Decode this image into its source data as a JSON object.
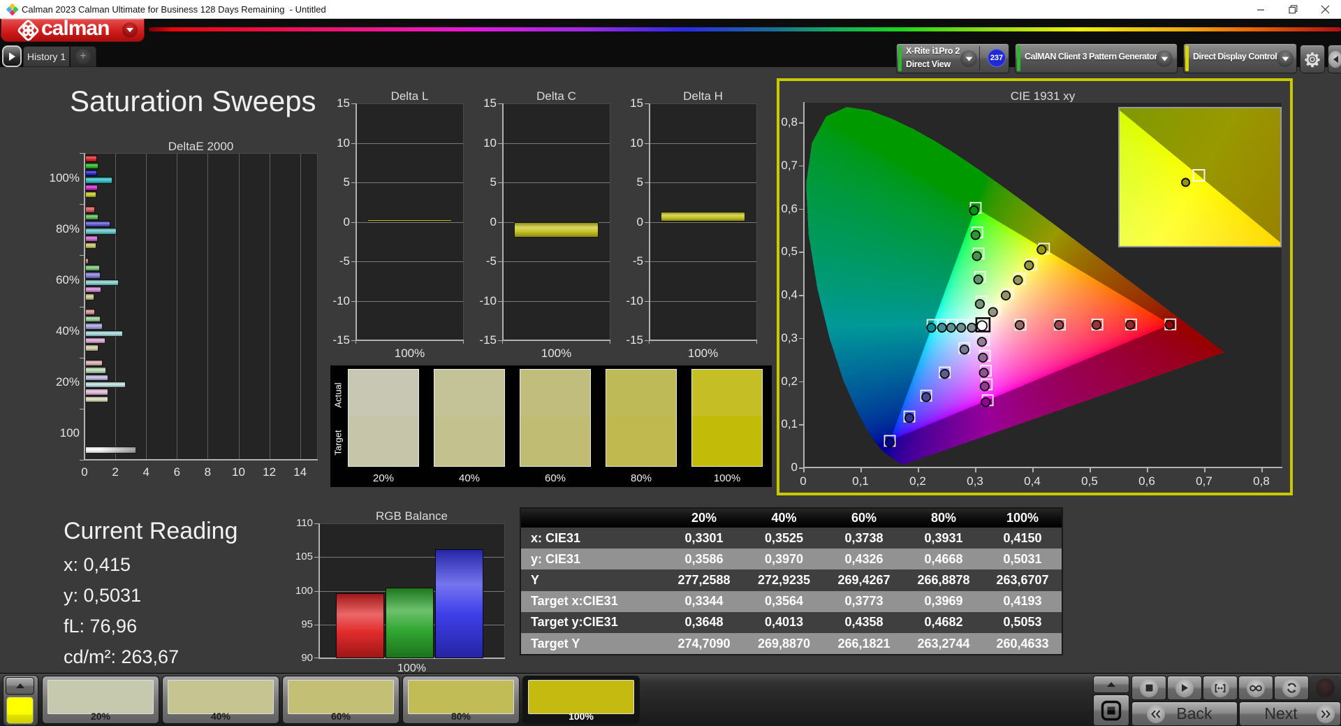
{
  "window": {
    "title": "Calman 2023 Calman Ultimate for Business 128 Days Remaining  - Untitled"
  },
  "header": {
    "logo_text": "calman",
    "meter": {
      "line1": "X-Rite i1Pro 2",
      "line2": "Direct View",
      "badge": "237"
    },
    "source": "CalMAN Client 3 Pattern Generator",
    "display_control": "Direct Display Control"
  },
  "tabs": {
    "history": "History 1",
    "add": "+"
  },
  "page": {
    "title": "Saturation Sweeps"
  },
  "chart_data": [
    {
      "id": "deltae2000",
      "type": "bar",
      "orientation": "horizontal",
      "title": "DeltaE 2000",
      "xlim": [
        0,
        15.2
      ],
      "xticks": [
        0,
        2,
        4,
        6,
        8,
        10,
        12,
        14
      ],
      "series_labels": [
        "red",
        "green",
        "blue",
        "cyan",
        "magenta",
        "yellow"
      ],
      "groups": [
        {
          "label": "100%",
          "values": [
            0.79,
            0.88,
            0.79,
            1.79,
            0.82,
            0.74
          ],
          "colors": [
            "#d42020",
            "#1fb81f",
            "#2222cc",
            "#2cbfc4",
            "#c828c8",
            "#c6c620"
          ]
        },
        {
          "label": "80%",
          "values": [
            0.62,
            0.88,
            1.65,
            2.03,
            0.8,
            0.74
          ],
          "colors": [
            "#d05050",
            "#52bb52",
            "#5b55cf",
            "#63c3c6",
            "#cc63cc",
            "#c6c45e"
          ]
        },
        {
          "label": "60%",
          "values": [
            0.24,
            0.97,
            1.0,
            2.18,
            1.06,
            0.59
          ],
          "colors": [
            "#cd7070",
            "#76c276",
            "#8379d4",
            "#85ccce",
            "#ce86ce",
            "#c9c787"
          ]
        },
        {
          "label": "40%",
          "values": [
            0.62,
            1.02,
            1.12,
            2.45,
            1.3,
            0.85
          ],
          "colors": [
            "#d29090",
            "#94cb94",
            "#a29ddb",
            "#a4d6d6",
            "#d6a3d2",
            "#cfcda2"
          ]
        },
        {
          "label": "20%",
          "values": [
            1.15,
            1.36,
            1.51,
            2.61,
            1.51,
            1.51
          ],
          "colors": [
            "#d8acac",
            "#b2d8b2",
            "#bcb6e3",
            "#b9dedd",
            "#dfb9d9",
            "#d6d5b4"
          ]
        },
        {
          "label": "100",
          "values": [
            3.3
          ],
          "colors": [
            "#ffffff"
          ]
        }
      ]
    },
    {
      "id": "delta_l",
      "type": "bar",
      "title": "Delta L",
      "ylim": [
        -15,
        15
      ],
      "yticks": [
        15,
        10,
        5,
        0,
        -5,
        -10,
        -15
      ],
      "category": "100%",
      "value": 0.3,
      "color": "#c6c41d"
    },
    {
      "id": "delta_c",
      "type": "bar",
      "title": "Delta C",
      "ylim": [
        -15,
        15
      ],
      "yticks": [
        15,
        10,
        5,
        0,
        -5,
        -10,
        -15
      ],
      "category": "100%",
      "value": -2.0,
      "color": "#c6c41d"
    },
    {
      "id": "delta_h",
      "type": "bar",
      "title": "Delta H",
      "ylim": [
        -15,
        15
      ],
      "yticks": [
        15,
        10,
        5,
        0,
        -5,
        -10,
        -15
      ],
      "category": "100%",
      "value": 1.3,
      "color": "#c6c41d"
    },
    {
      "id": "saturation_swatches",
      "type": "table",
      "row_labels": [
        "Actual",
        "Target"
      ],
      "levels": [
        "20%",
        "40%",
        "60%",
        "80%",
        "100%"
      ],
      "actual": [
        "#c7c7b4",
        "#c4c297",
        "#c1bd7c",
        "#bfba58",
        "#c5be24"
      ],
      "target": [
        "#c6c5a9",
        "#c3c18e",
        "#c0bc73",
        "#bfb94f",
        "#c2bb07"
      ]
    },
    {
      "id": "cie1931",
      "type": "scatter",
      "title": "CIE 1931 xy",
      "xlim": [
        0,
        0.8366
      ],
      "ylim": [
        0,
        0.8469
      ],
      "xtick_labels": [
        "0",
        "0,1",
        "0,2",
        "0,3",
        "0,4",
        "0,5",
        "0,6",
        "0,7",
        "0,8"
      ],
      "ytick_labels": [
        "0",
        "0,1",
        "0,2",
        "0,3",
        "0,4",
        "0,5",
        "0,6",
        "0,7",
        "0,8"
      ],
      "gamut": {
        "red": [
          0.64,
          0.33
        ],
        "green": [
          0.3,
          0.6
        ],
        "blue": [
          0.15,
          0.06
        ]
      },
      "white_point": {
        "target": [
          0.3127,
          0.329
        ],
        "measured": [
          0.311,
          0.3267
        ]
      },
      "sweeps": {
        "red": {
          "target": [
            [
              0.3782,
              0.3292
            ],
            [
              0.4469,
              0.3294
            ],
            [
              0.5124,
              0.3296
            ],
            [
              0.5713,
              0.3298
            ],
            [
              0.64,
              0.33
            ]
          ],
          "measured": [
            [
              0.3767,
              0.3284
            ],
            [
              0.4454,
              0.3286
            ],
            [
              0.5109,
              0.3288
            ],
            [
              0.5698,
              0.329
            ],
            [
              0.6385,
              0.3292
            ]
          ]
        },
        "green": {
          "target": [
            [
              0.3102,
              0.3832
            ],
            [
              0.3075,
              0.4401
            ],
            [
              0.305,
              0.4943
            ],
            [
              0.3027,
              0.5431
            ],
            [
              0.3,
              0.6
            ]
          ],
          "measured": [
            [
              0.3072,
              0.3772
            ],
            [
              0.3045,
              0.4341
            ],
            [
              0.302,
              0.4883
            ],
            [
              0.2997,
              0.5371
            ],
            [
              0.297,
              0.594
            ]
          ]
        },
        "blue": {
          "target": [
            [
              0.2802,
              0.2752
            ],
            [
              0.246,
              0.2187
            ],
            [
              0.2135,
              0.1649
            ],
            [
              0.1842,
              0.1165
            ],
            [
              0.15,
              0.06
            ]
          ],
          "measured": [
            [
              0.2802,
              0.2717
            ],
            [
              0.246,
              0.2152
            ],
            [
              0.2135,
              0.1614
            ],
            [
              0.1842,
              0.113
            ],
            [
              0.15,
              0.0565
            ]
          ]
        },
        "cyan": {
          "target": [
            [
              0.2951,
              0.3289
            ],
            [
              0.2766,
              0.3289
            ],
            [
              0.259,
              0.3288
            ],
            [
              0.2431,
              0.3288
            ],
            [
              0.2246,
              0.3287
            ]
          ],
          "measured": [
            [
              0.2931,
              0.3224
            ],
            [
              0.2746,
              0.3224
            ],
            [
              0.257,
              0.3223
            ],
            [
              0.2411,
              0.3223
            ],
            [
              0.2226,
              0.3222
            ]
          ]
        },
        "magenta": {
          "target": [
            [
              0.3143,
              0.294
            ],
            [
              0.3161,
              0.2573
            ],
            [
              0.3177,
              0.2224
            ],
            [
              0.3192,
              0.1909
            ],
            [
              0.3209,
              0.1542
            ]
          ],
          "measured": [
            [
              0.3108,
              0.2895
            ],
            [
              0.3126,
              0.2528
            ],
            [
              0.3142,
              0.2179
            ],
            [
              0.3157,
              0.1864
            ],
            [
              0.3174,
              0.1497
            ]
          ]
        },
        "yellow": {
          "target": [
            [
              0.3344,
              0.3648
            ],
            [
              0.3564,
              0.4013
            ],
            [
              0.3773,
              0.4358
            ],
            [
              0.3969,
              0.4682
            ],
            [
              0.4193,
              0.5053
            ]
          ],
          "measured": [
            [
              0.3301,
              0.3586
            ],
            [
              0.3525,
              0.397
            ],
            [
              0.3738,
              0.4326
            ],
            [
              0.3931,
              0.4668
            ],
            [
              0.415,
              0.5031
            ]
          ]
        }
      },
      "inset": {
        "x0": 0.3935,
        "x1": 0.4458,
        "y0": 0.4831,
        "y1": 0.5264,
        "target": [
          0.4193,
          0.5053
        ],
        "measured": [
          0.415,
          0.5031
        ]
      }
    },
    {
      "id": "rgb_balance",
      "type": "bar",
      "title": "RGB Balance",
      "categories": [
        "Red",
        "Green",
        "Blue"
      ],
      "values": [
        99.6,
        100.5,
        106.2
      ],
      "colors": [
        "#e02020",
        "#28a428",
        "#3434e8"
      ],
      "ylim": [
        90,
        110
      ],
      "yticks": [
        110,
        105,
        100,
        95,
        90
      ],
      "xlabel": "100%"
    }
  ],
  "current_reading": {
    "title": "Current Reading",
    "lines": [
      "x: 0,415",
      "y: 0,5031",
      "fL: 76,96",
      "cd/m²: 263,67"
    ]
  },
  "table": {
    "headers": [
      "",
      "20%",
      "40%",
      "60%",
      "80%",
      "100%"
    ],
    "rows": [
      {
        "label": "x: CIE31",
        "values": [
          "0,3301",
          "0,3525",
          "0,3738",
          "0,3931",
          "0,4150"
        ]
      },
      {
        "label": "y: CIE31",
        "values": [
          "0,3586",
          "0,3970",
          "0,4326",
          "0,4668",
          "0,5031"
        ]
      },
      {
        "label": "Y",
        "values": [
          "277,2588",
          "272,9235",
          "269,4267",
          "266,8878",
          "263,6707"
        ]
      },
      {
        "label": "Target x:CIE31",
        "values": [
          "0,3344",
          "0,3564",
          "0,3773",
          "0,3969",
          "0,4193"
        ]
      },
      {
        "label": "Target y:CIE31",
        "values": [
          "0,3648",
          "0,4013",
          "0,4358",
          "0,4682",
          "0,5053"
        ]
      },
      {
        "label": "Target Y",
        "values": [
          "274,7090",
          "269,8870",
          "266,1821",
          "263,2744",
          "260,4633"
        ]
      }
    ]
  },
  "bottom_bar": {
    "pattern_color": "#ffff00",
    "swatches": [
      {
        "label": "20%",
        "color": "#c6c9ae",
        "selected": false
      },
      {
        "label": "40%",
        "color": "#c6c490",
        "selected": false
      },
      {
        "label": "60%",
        "color": "#c3bf75",
        "selected": false
      },
      {
        "label": "80%",
        "color": "#c2bc56",
        "selected": false
      },
      {
        "label": "100%",
        "color": "#c5bb10",
        "selected": true
      }
    ],
    "back_label": "Back",
    "next_label": "Next"
  }
}
